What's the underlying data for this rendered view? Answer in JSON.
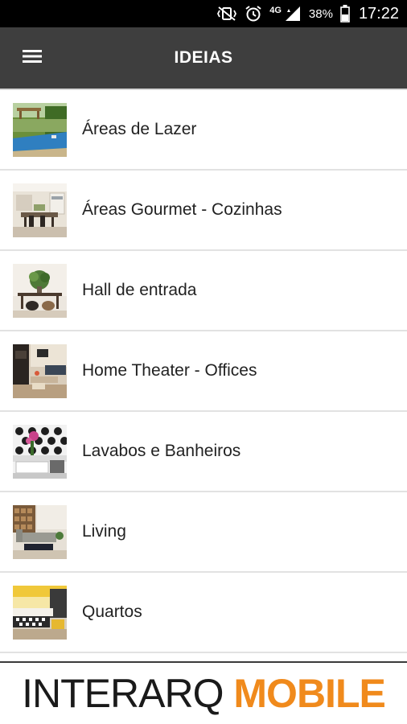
{
  "status_bar": {
    "network_label": "4G",
    "battery_percent": "38%",
    "time": "17:22",
    "icons": [
      "vibrate-mute-icon",
      "alarm-icon",
      "network-4g-icon",
      "signal-icon",
      "battery-icon"
    ]
  },
  "app_bar": {
    "title": "IDEIAS",
    "menu_icon": "hamburger-menu-icon",
    "background_color": "#3e3e3e"
  },
  "list": {
    "items": [
      {
        "label": "Áreas de Lazer",
        "thumbnail": "pool-garden-thumbnail"
      },
      {
        "label": "Áreas Gourmet - Cozinhas",
        "thumbnail": "gourmet-kitchen-thumbnail"
      },
      {
        "label": "Hall de entrada",
        "thumbnail": "entrance-hall-thumbnail"
      },
      {
        "label": "Home Theater - Offices",
        "thumbnail": "home-theater-thumbnail"
      },
      {
        "label": "Lavabos e Banheiros",
        "thumbnail": "bathroom-thumbnail"
      },
      {
        "label": "Living",
        "thumbnail": "living-room-thumbnail"
      },
      {
        "label": "Quartos",
        "thumbnail": "bedroom-thumbnail"
      }
    ]
  },
  "footer": {
    "brand_part1": "INTERARQ",
    "brand_part2": "MOBILE",
    "brand_colors": {
      "dark": "#1a1a1a",
      "accent": "#f08a1c"
    }
  }
}
